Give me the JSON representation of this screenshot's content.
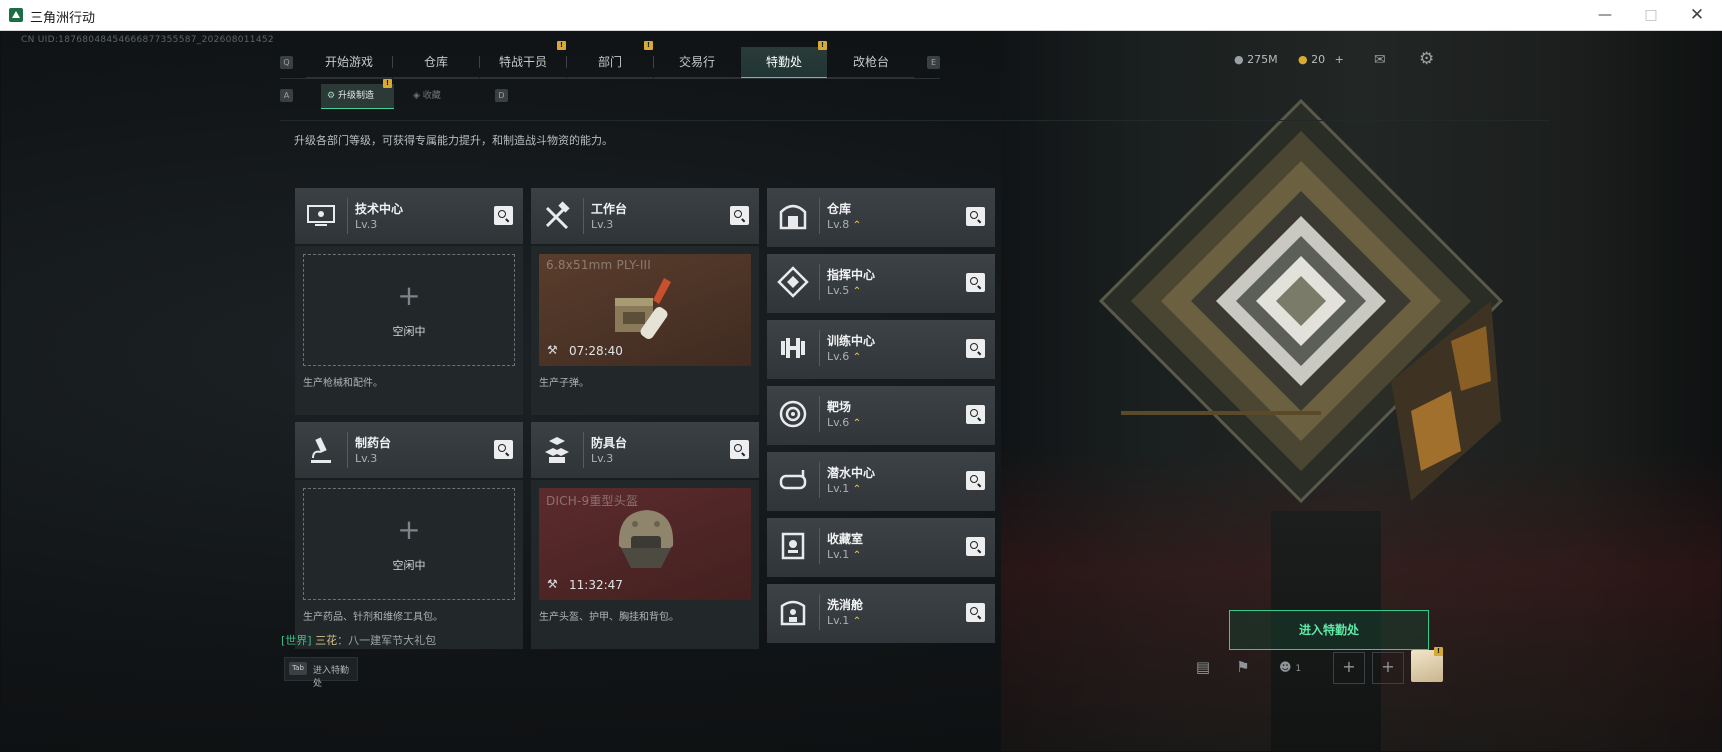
{
  "window": {
    "title": "三角洲行动"
  },
  "uid": "CN UID:18768048454666877355587_202608011452",
  "main_tabs": [
    {
      "label": "开始游戏",
      "badge": ""
    },
    {
      "label": "仓库",
      "badge": ""
    },
    {
      "label": "特战干员",
      "badge": "!"
    },
    {
      "label": "部门",
      "badge": "!"
    },
    {
      "label": "交易行",
      "badge": ""
    },
    {
      "label": "特勤处",
      "badge": "!",
      "active": true
    },
    {
      "label": "改枪台",
      "badge": ""
    }
  ],
  "key_hints": {
    "tabs_left": "Q",
    "tabs_right": "E",
    "sub_left": "A",
    "sub_right": "D"
  },
  "sub_tabs": [
    {
      "label": "升级制造",
      "badge": "!",
      "active": true
    },
    {
      "label": "收藏",
      "badge": ""
    }
  ],
  "currency": {
    "coins": "275M",
    "tickets": "20",
    "add": "+"
  },
  "description": "升级各部门等级，可获得专属能力提升，和制造战斗物资的能力。",
  "workshops": [
    {
      "name": "技术中心",
      "level": "Lv.3",
      "status": "空闲中",
      "plus": "+",
      "caption": "生产枪械和配件。",
      "icon": "computer-icon"
    },
    {
      "name": "工作台",
      "level": "Lv.3",
      "item": "6.8x51mm PLY-III",
      "timer": "07:28:40",
      "caption": "生产子弹。",
      "icon": "tools-icon"
    },
    {
      "name": "制药台",
      "level": "Lv.3",
      "status": "空闲中",
      "plus": "+",
      "caption": "生产药品、针剂和维修工具包。",
      "icon": "microscope-icon"
    },
    {
      "name": "防具台",
      "level": "Lv.3",
      "item": "DICH-9重型头盔",
      "timer": "11:32:47",
      "caption": "生产头盔、护甲、胸挂和背包。",
      "icon": "armor-blocks-icon"
    }
  ],
  "departments": [
    {
      "name": "仓库",
      "level": "Lv.8",
      "icon": "warehouse-icon"
    },
    {
      "name": "指挥中心",
      "level": "Lv.5",
      "icon": "command-icon"
    },
    {
      "name": "训练中心",
      "level": "Lv.6",
      "icon": "dumbbell-icon"
    },
    {
      "name": "靶场",
      "level": "Lv.6",
      "icon": "target-icon"
    },
    {
      "name": "潜水中心",
      "level": "Lv.1",
      "icon": "diving-mask-icon"
    },
    {
      "name": "收藏室",
      "level": "Lv.1",
      "icon": "collection-icon"
    },
    {
      "name": "洗消舱",
      "level": "Lv.1",
      "icon": "decon-icon"
    }
  ],
  "enter_button": "进入特勤处",
  "chat": {
    "channel": "[世界]",
    "sender": "三花",
    "message": "：八一建军节大礼包"
  },
  "tab_hint": {
    "key": "Tab",
    "label": "进入特勤处"
  },
  "bottom_bar": {
    "friends_count": "1",
    "avatar_badge": "!"
  },
  "colors": {
    "accent": "#46d39a",
    "badge": "#d8a933",
    "panel": "#303539",
    "ammo_bg": "#4b3327",
    "helmet_bg": "#4e2426"
  }
}
